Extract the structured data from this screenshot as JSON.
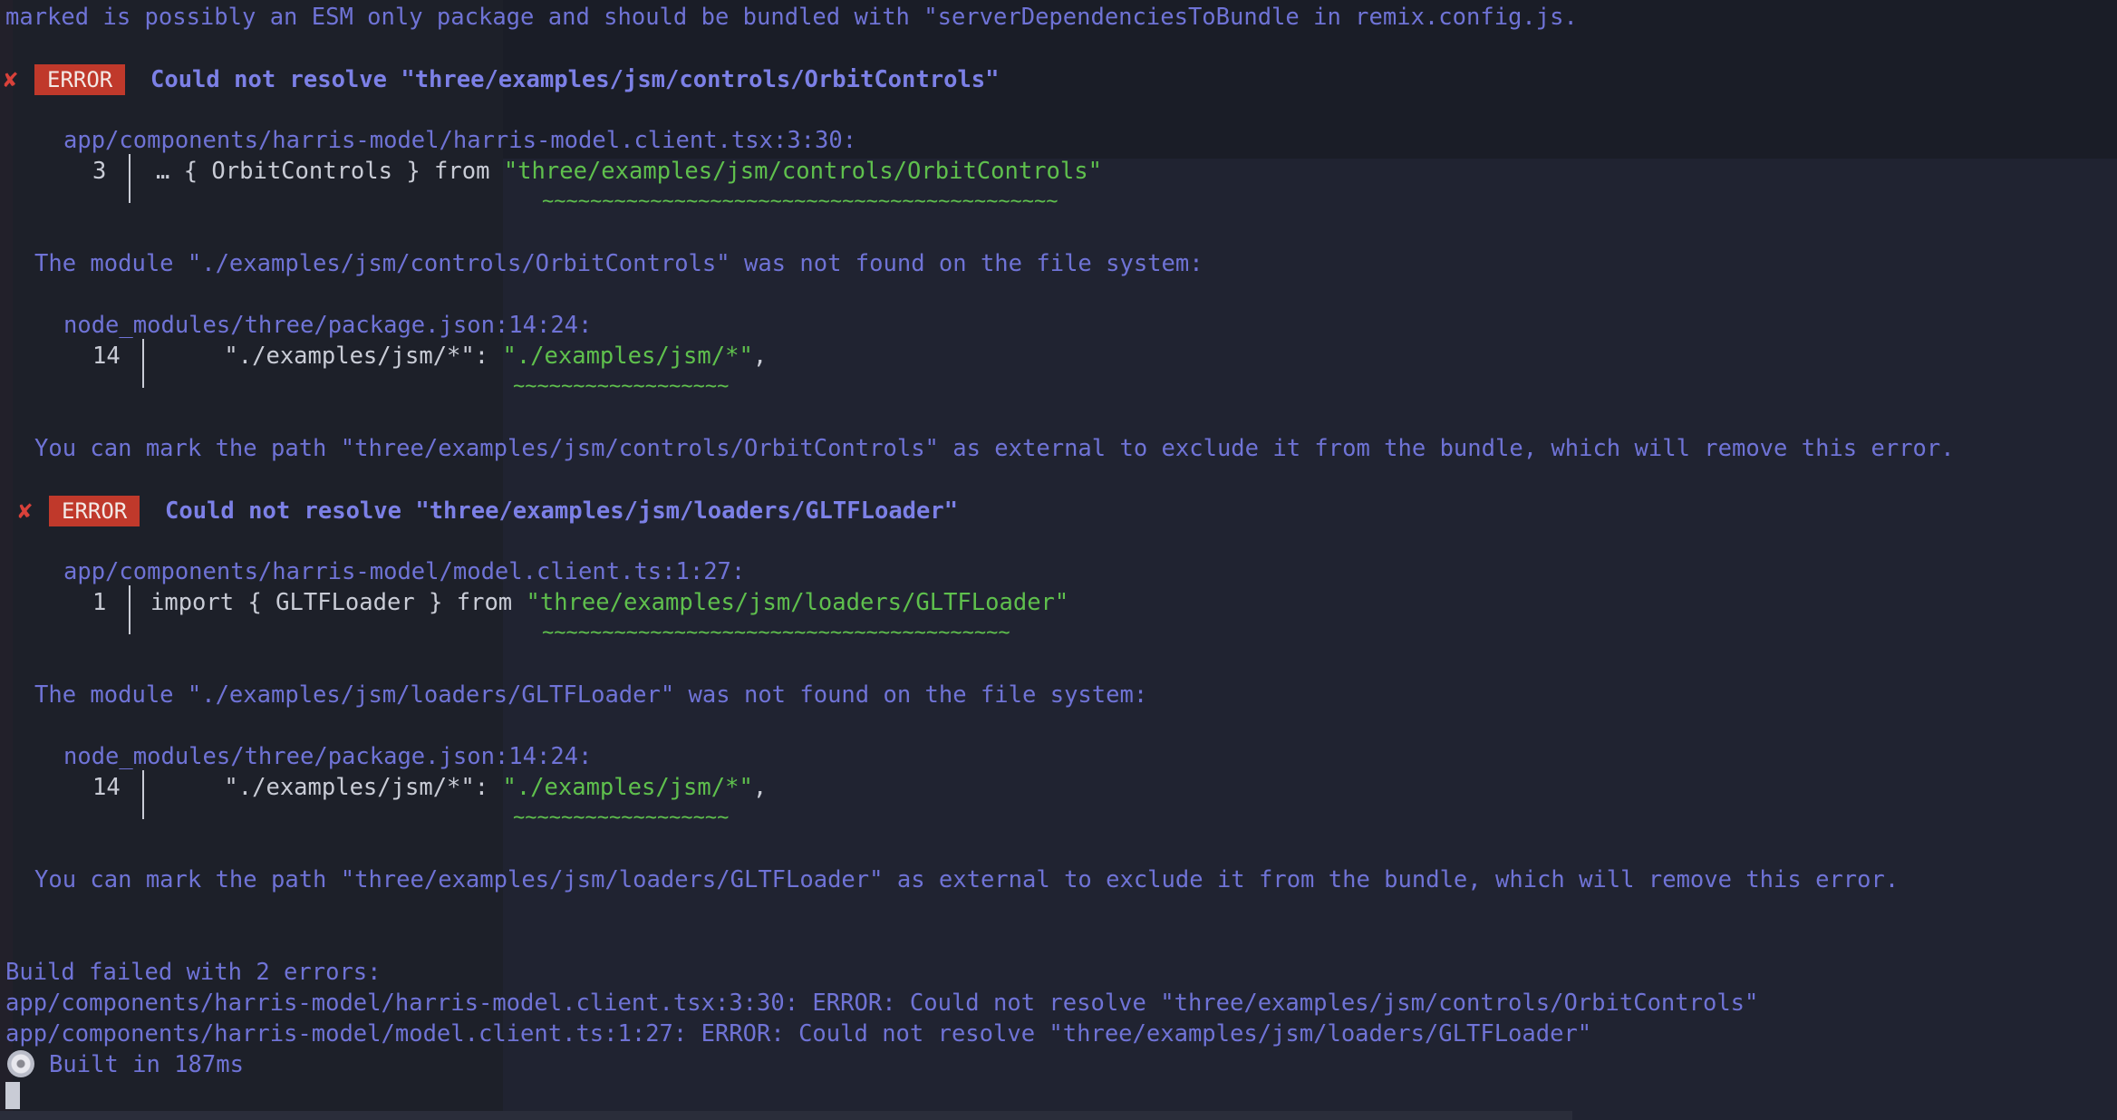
{
  "terminal": {
    "top_line": "marked is possibly an ESM only package and should be bundled with \"serverDependenciesToBundle in remix.config.js.",
    "errors": [
      {
        "mark": "✘",
        "badge": "ERROR",
        "title": "Could not resolve \"three/examples/jsm/controls/OrbitControls\"",
        "location": "app/components/harris-model/harris-model.client.tsx:3:30:",
        "line_number": "3",
        "code_prefix": "… { OrbitControls } from ",
        "code_string": "\"three/examples/jsm/controls/OrbitControls\"",
        "underline": "~~~~~~~~~~~~~~~~~~~~~~~~~~~~~~~~~~~~~~~~~~~",
        "note": "The module \"./examples/jsm/controls/OrbitControls\" was not found on the file system:",
        "note_location": "node_modules/three/package.json:14:24:",
        "note_line_number": "14",
        "note_code_prefix": "    \"./examples/jsm/*\": ",
        "note_code_string": "\"./examples/jsm/*\"",
        "note_code_suffix": ",",
        "note_underline": "~~~~~~~~~~~~~~~~~~",
        "hint": "You can mark the path \"three/examples/jsm/controls/OrbitControls\" as external to exclude it from the bundle, which will remove this error."
      },
      {
        "mark": "✘",
        "badge": "ERROR",
        "title": "Could not resolve \"three/examples/jsm/loaders/GLTFLoader\"",
        "location": "app/components/harris-model/model.client.ts:1:27:",
        "line_number": "1",
        "code_prefix": "import { GLTFLoader } from ",
        "code_string": "\"three/examples/jsm/loaders/GLTFLoader\"",
        "underline": "~~~~~~~~~~~~~~~~~~~~~~~~~~~~~~~~~~~~~~~",
        "note": "The module \"./examples/jsm/loaders/GLTFLoader\" was not found on the file system:",
        "note_location": "node_modules/three/package.json:14:24:",
        "note_line_number": "14",
        "note_code_prefix": "    \"./examples/jsm/*\": ",
        "note_code_string": "\"./examples/jsm/*\"",
        "note_code_suffix": ",",
        "note_underline": "~~~~~~~~~~~~~~~~~~",
        "hint": "You can mark the path \"three/examples/jsm/loaders/GLTFLoader\" as external to exclude it from the bundle, which will remove this error."
      }
    ],
    "summary": {
      "header": "Build failed with 2 errors:",
      "line1": "app/components/harris-model/harris-model.client.tsx:3:30: ERROR: Could not resolve \"three/examples/jsm/controls/OrbitControls\"",
      "line2": "app/components/harris-model/model.client.ts:1:27: ERROR: Could not resolve \"three/examples/jsm/loaders/GLTFLoader\""
    },
    "built_icon": "disc-icon",
    "built_text": "Built in 187ms"
  },
  "colors": {
    "background": "#1a1d27",
    "message": "#6f73d6",
    "error_badge": "#c0392b",
    "error_mark": "#d9413a",
    "string": "#5fc04d",
    "code": "#c9ccd6"
  }
}
